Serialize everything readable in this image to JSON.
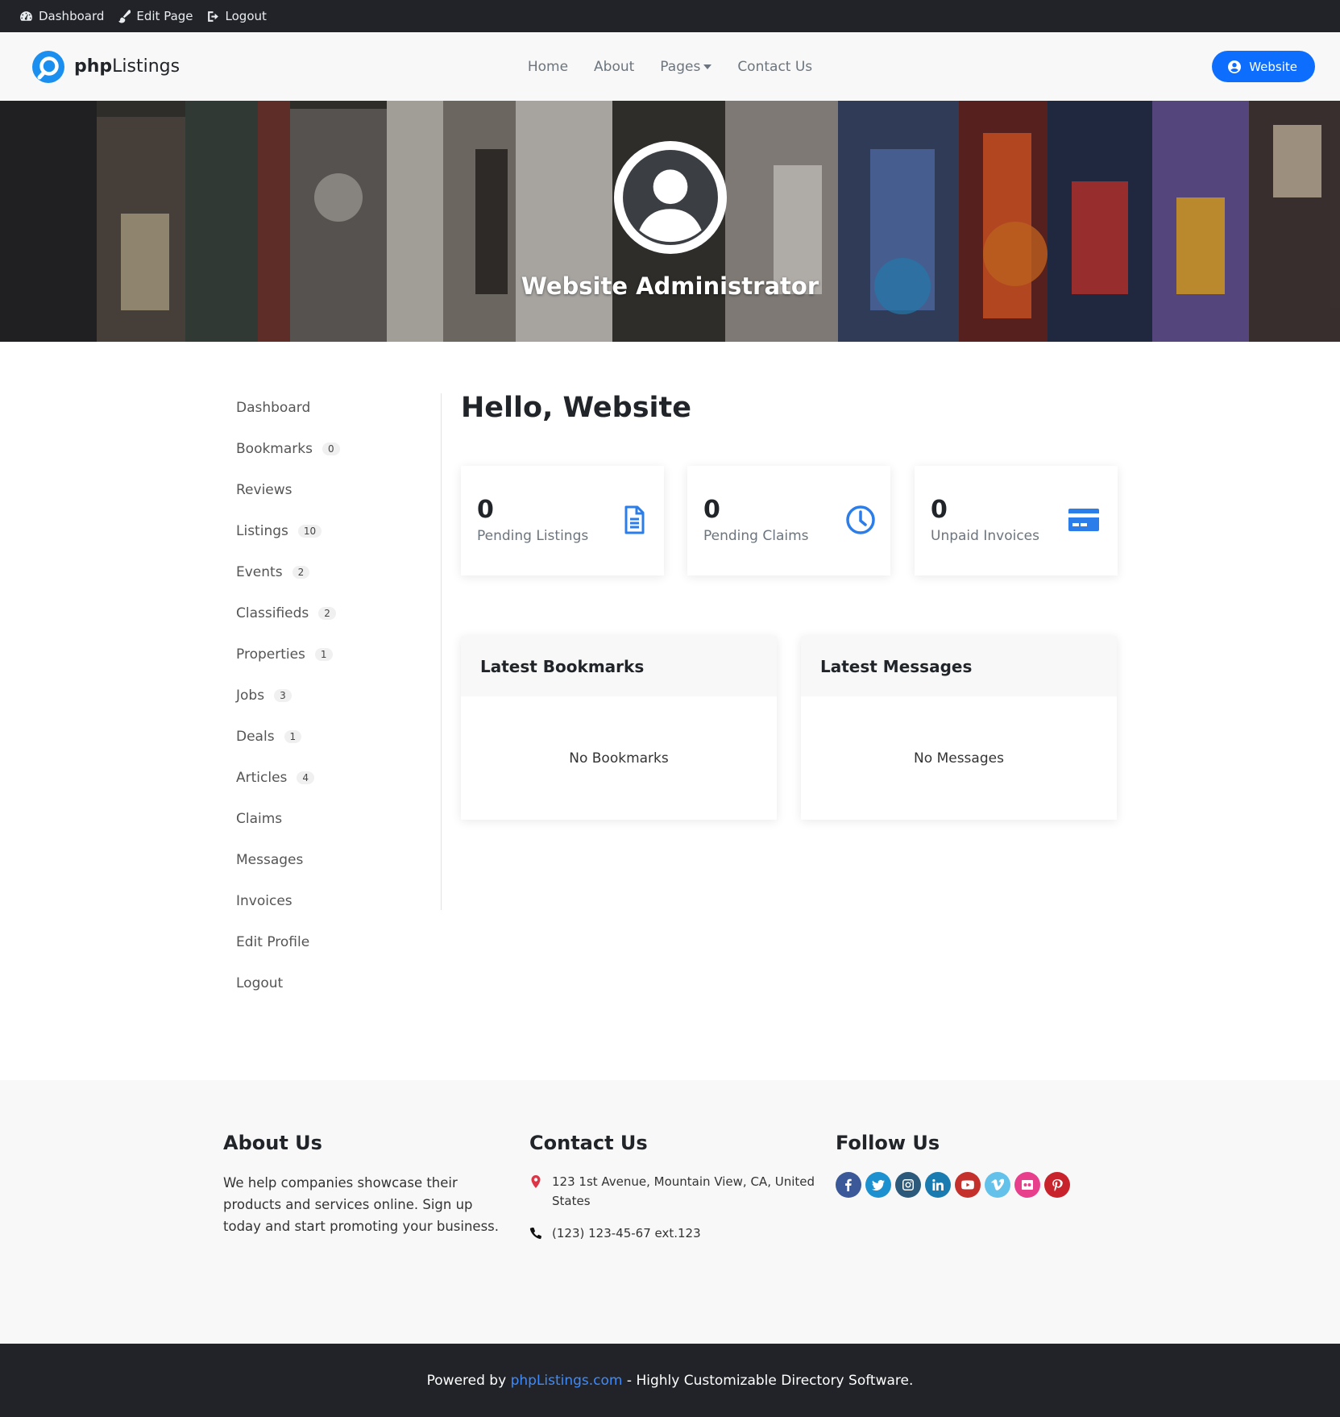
{
  "admin_bar": {
    "items": [
      {
        "label": "Dashboard",
        "icon": "gauge-icon"
      },
      {
        "label": "Edit Page",
        "icon": "brush-icon"
      },
      {
        "label": "Logout",
        "icon": "sign-out-icon"
      }
    ]
  },
  "navbar": {
    "brand_bold": "php",
    "brand_rest": "Listings",
    "menu": [
      {
        "label": "Home"
      },
      {
        "label": "About"
      },
      {
        "label": "Pages",
        "has_dropdown": true
      },
      {
        "label": "Contact Us"
      }
    ],
    "website_button": "Website"
  },
  "hero": {
    "name": "Website Administrator"
  },
  "sidebar": {
    "items": [
      {
        "label": "Dashboard",
        "count": ""
      },
      {
        "label": "Bookmarks",
        "count": "0"
      },
      {
        "label": "Reviews",
        "count": ""
      },
      {
        "label": "Listings",
        "count": "10"
      },
      {
        "label": "Events",
        "count": "2"
      },
      {
        "label": "Classifieds",
        "count": "2"
      },
      {
        "label": "Properties",
        "count": "1"
      },
      {
        "label": "Jobs",
        "count": "3"
      },
      {
        "label": "Deals",
        "count": "1"
      },
      {
        "label": "Articles",
        "count": "4"
      },
      {
        "label": "Claims",
        "count": ""
      },
      {
        "label": "Messages",
        "count": ""
      },
      {
        "label": "Invoices",
        "count": ""
      },
      {
        "label": "Edit Profile",
        "count": ""
      },
      {
        "label": "Logout",
        "count": ""
      }
    ]
  },
  "dashboard": {
    "greeting": "Hello, Website",
    "stats": [
      {
        "value": "0",
        "label": "Pending Listings",
        "icon": "file-icon"
      },
      {
        "value": "0",
        "label": "Pending Claims",
        "icon": "clock-icon"
      },
      {
        "value": "0",
        "label": "Unpaid Invoices",
        "icon": "credit-card-icon"
      }
    ],
    "bookmarks": {
      "title": "Latest Bookmarks",
      "empty": "No Bookmarks"
    },
    "messages": {
      "title": "Latest Messages",
      "empty": "No Messages"
    }
  },
  "footer": {
    "about": {
      "title": "About Us",
      "text": "We help companies showcase their products and services online. Sign up today and start promoting your business."
    },
    "contact": {
      "title": "Contact Us",
      "address": "123 1st Avenue, Mountain View, CA, United States",
      "phone": "(123) 123-45-67 ext.123"
    },
    "follow": {
      "title": "Follow Us",
      "networks": [
        {
          "name": "facebook-icon",
          "color": "#3b5998"
        },
        {
          "name": "twitter-icon",
          "color": "#1d91d0"
        },
        {
          "name": "instagram-icon",
          "color": "#2d5a7b"
        },
        {
          "name": "linkedin-icon",
          "color": "#1a7bb0"
        },
        {
          "name": "youtube-icon",
          "color": "#c4302b"
        },
        {
          "name": "vimeo-icon",
          "color": "#63c1ea"
        },
        {
          "name": "flickr-icon",
          "color": "#e83f8d"
        },
        {
          "name": "pinterest-icon",
          "color": "#c8232c"
        }
      ]
    }
  },
  "bottom_bar": {
    "prefix": "Powered by ",
    "link": "phpListings.com",
    "suffix": " - Highly Customizable Directory Software."
  },
  "colors": {
    "accent": "#0d6efd",
    "icon_blue": "#2b7de9",
    "dark": "#212328"
  }
}
